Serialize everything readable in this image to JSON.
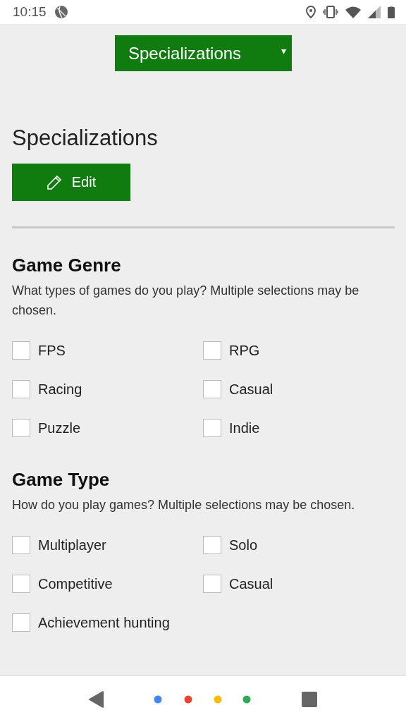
{
  "status_bar": {
    "time": "10:15"
  },
  "dropdown": {
    "value": "Specializations",
    "caret": "▾"
  },
  "page_title": "Specializations",
  "edit_button": {
    "label": "Edit"
  },
  "sections": [
    {
      "heading": "Game Genre",
      "description": "What types of games do you play? Multiple selections may be chosen.",
      "options": [
        {
          "label": "FPS",
          "checked": false
        },
        {
          "label": "RPG",
          "checked": false
        },
        {
          "label": "Racing",
          "checked": false
        },
        {
          "label": "Casual",
          "checked": false
        },
        {
          "label": "Puzzle",
          "checked": false
        },
        {
          "label": "Indie",
          "checked": false
        }
      ]
    },
    {
      "heading": "Game Type",
      "description": "How do you play games? Multiple selections may be chosen.",
      "options": [
        {
          "label": "Multiplayer",
          "checked": false
        },
        {
          "label": "Solo",
          "checked": false
        },
        {
          "label": "Competitive",
          "checked": false
        },
        {
          "label": "Casual",
          "checked": false
        },
        {
          "label": "Achievement hunting",
          "checked": false
        }
      ]
    }
  ]
}
